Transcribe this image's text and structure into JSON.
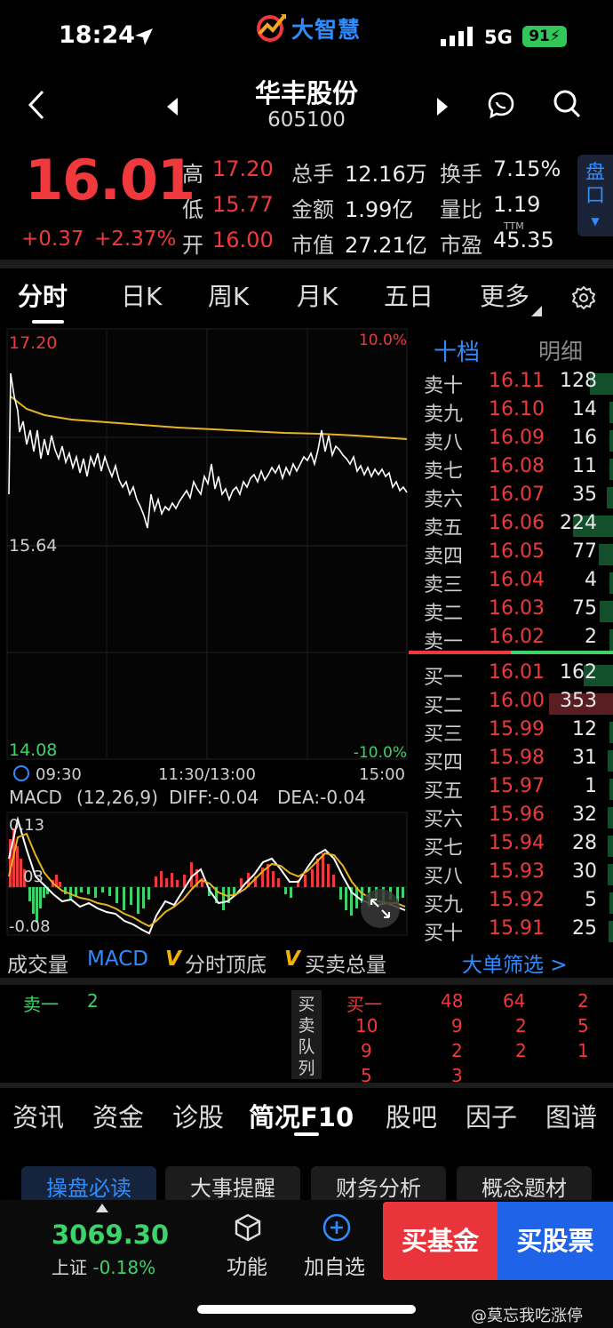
{
  "status_bar": {
    "time": "18:24",
    "brand": "大智慧",
    "network": "5G",
    "battery": "91"
  },
  "header": {
    "name": "华丰股份",
    "code": "605100"
  },
  "quote": {
    "price": "16.01",
    "change": "+0.37",
    "change_pct": "+2.37%",
    "labels": {
      "high": "高",
      "low": "低",
      "open": "开",
      "volume": "总手",
      "amount": "金额",
      "mcap": "市值",
      "turnover": "换手",
      "vol_ratio": "量比",
      "pe": "市盈"
    },
    "values": {
      "high": "17.20",
      "low": "15.77",
      "open": "16.00",
      "volume": "12.16万",
      "amount": "1.99亿",
      "mcap": "27.21亿",
      "turnover": "7.15%",
      "vol_ratio": "1.19",
      "pe": "45.35"
    },
    "tm": "TTM",
    "pankou": "盘口"
  },
  "tabs": [
    "分时",
    "日K",
    "周K",
    "月K",
    "五日",
    "更多"
  ],
  "chart": {
    "price_top": "17.20",
    "price_mid": "15.64",
    "price_bottom": "14.08",
    "pct_top": "10.0%",
    "pct_bottom": "-10.0%",
    "time_start": "09:30",
    "time_mid": "11:30/13:00",
    "time_end": "15:00",
    "macd_title": "MACD",
    "macd_params": "(12,26,9)",
    "diff": "DIFF:-0.04",
    "dea": "DEA:-0.04",
    "macd_top": "0.13",
    "macd_mid": "03",
    "macd_bottom": "-0.08"
  },
  "order_book": {
    "tab_active": "十档",
    "tab_other": "明细",
    "asks": [
      {
        "label": "卖十",
        "price": "16.11",
        "vol": "128",
        "bar": 0.36
      },
      {
        "label": "卖九",
        "price": "16.10",
        "vol": "14",
        "bar": 0.04
      },
      {
        "label": "卖八",
        "price": "16.09",
        "vol": "16",
        "bar": 0.05
      },
      {
        "label": "卖七",
        "price": "16.08",
        "vol": "11",
        "bar": 0.03
      },
      {
        "label": "卖六",
        "price": "16.07",
        "vol": "35",
        "bar": 0.1
      },
      {
        "label": "卖五",
        "price": "16.06",
        "vol": "224",
        "bar": 0.63
      },
      {
        "label": "卖四",
        "price": "16.05",
        "vol": "77",
        "bar": 0.22
      },
      {
        "label": "卖三",
        "price": "16.04",
        "vol": "4",
        "bar": 0.01
      },
      {
        "label": "卖二",
        "price": "16.03",
        "vol": "75",
        "bar": 0.21
      },
      {
        "label": "卖一",
        "price": "16.02",
        "vol": "2",
        "bar": 0.01
      }
    ],
    "bids": [
      {
        "label": "买一",
        "price": "16.01",
        "vol": "162",
        "bar": 0.46
      },
      {
        "label": "买二",
        "price": "16.00",
        "vol": "353",
        "bar": 1.0
      },
      {
        "label": "买三",
        "price": "15.99",
        "vol": "12",
        "bar": 0.03
      },
      {
        "label": "买四",
        "price": "15.98",
        "vol": "31",
        "bar": 0.09
      },
      {
        "label": "买五",
        "price": "15.97",
        "vol": "1",
        "bar": 0.01
      },
      {
        "label": "买六",
        "price": "15.96",
        "vol": "32",
        "bar": 0.09
      },
      {
        "label": "买七",
        "price": "15.94",
        "vol": "28",
        "bar": 0.08
      },
      {
        "label": "买八",
        "price": "15.93",
        "vol": "30",
        "bar": 0.08
      },
      {
        "label": "买九",
        "price": "15.92",
        "vol": "5",
        "bar": 0.01
      },
      {
        "label": "买十",
        "price": "15.91",
        "vol": "25",
        "bar": 0.07
      }
    ]
  },
  "indicators": {
    "volume": "成交量",
    "macd": "MACD",
    "top_bottom": "分时顶底",
    "buy_sell": "买卖总量",
    "filter": "大单筛选 >"
  },
  "queue": {
    "sell_label": "卖一",
    "sell_val": "2",
    "mid_label": "买卖队列",
    "buy_label": "买一",
    "rows": [
      [
        "48",
        "64",
        "2"
      ],
      [
        "10",
        "9",
        "2",
        "5"
      ],
      [
        "9",
        "2",
        "2",
        "1"
      ],
      [
        "5",
        "3"
      ]
    ]
  },
  "bottom_tabs": [
    "资讯",
    "资金",
    "诊股",
    "简况F10",
    "股吧",
    "因子",
    "图谱"
  ],
  "chips": [
    "操盘必读",
    "大事提醒",
    "财务分析",
    "概念题材"
  ],
  "footer": {
    "index_value": "3069.30",
    "index_name": "上证",
    "index_change": "-0.18%",
    "func": "功能",
    "add_watch": "加自选",
    "buy_fund": "买基金",
    "buy_stock": "买股票"
  },
  "watermark": "@莫忘我吃涨停",
  "colors": {
    "up": "#f0393c",
    "down": "#3ed26b",
    "accent": "#2f8cff",
    "avg_line": "#e6b422"
  }
}
